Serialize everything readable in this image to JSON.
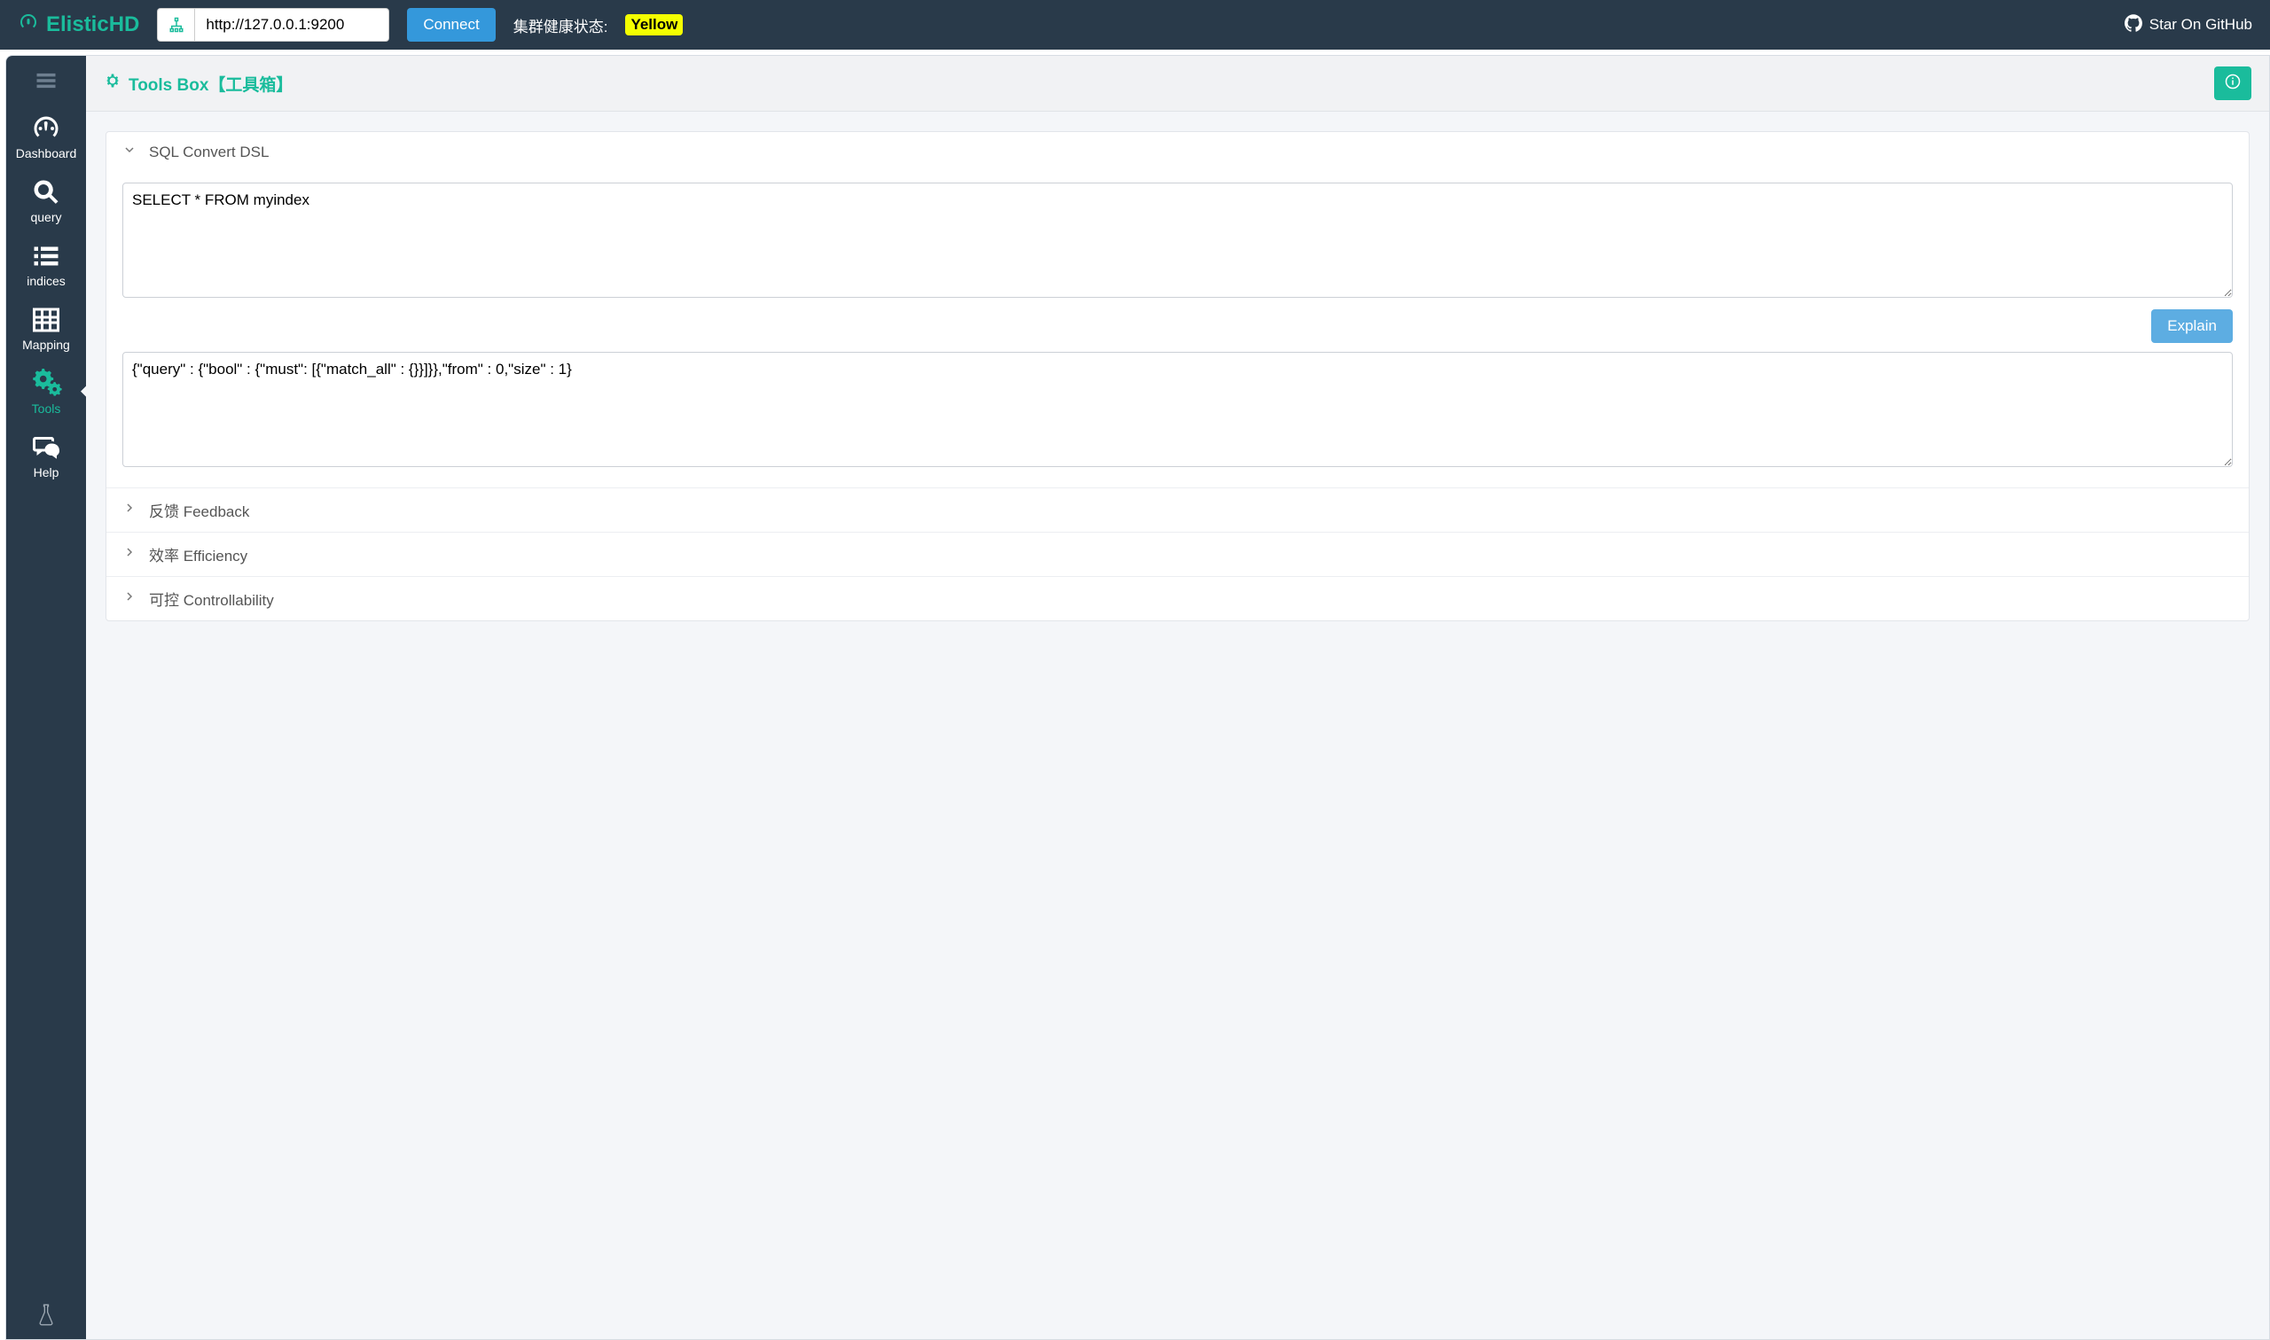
{
  "header": {
    "brand": "ElisticHD",
    "url_value": "http://127.0.0.1:9200",
    "connect_label": "Connect",
    "health_label": "集群健康状态:",
    "health_value": "Yellow",
    "github_label": "Star On GitHub"
  },
  "sidebar": {
    "items": [
      {
        "id": "dashboard",
        "label": "Dashboard"
      },
      {
        "id": "query",
        "label": "query"
      },
      {
        "id": "indices",
        "label": "indices"
      },
      {
        "id": "mapping",
        "label": "Mapping"
      },
      {
        "id": "tools",
        "label": "Tools"
      },
      {
        "id": "help",
        "label": "Help"
      }
    ]
  },
  "page": {
    "title": "Tools Box【工具箱】"
  },
  "accordion": {
    "sql_title": "SQL Convert DSL",
    "sql_input": "SELECT * FROM myindex",
    "explain_label": "Explain",
    "dsl_output": "{\"query\" : {\"bool\" : {\"must\": [{\"match_all\" : {}}]}},\"from\" : 0,\"size\" : 1}",
    "feedback_title": "反馈 Feedback",
    "efficiency_title": "效率 Efficiency",
    "controllability_title": "可控 Controllability"
  },
  "colors": {
    "brand_green": "#1abc9c",
    "header_bg": "#293a4a",
    "blue": "#3498db",
    "yellow": "#f4ff00"
  }
}
